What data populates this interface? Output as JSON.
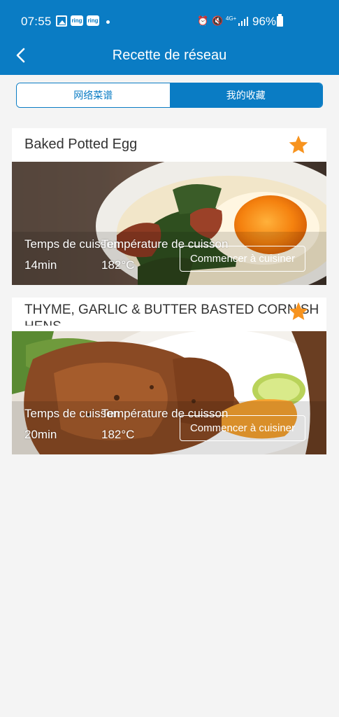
{
  "status": {
    "time": "07:55",
    "ring_label": "ring",
    "network": "4G+",
    "battery": "96%"
  },
  "header": {
    "title": "Recette de réseau"
  },
  "tabs": [
    {
      "label": "网络菜谱"
    },
    {
      "label": "我的收藏"
    }
  ],
  "recipes": [
    {
      "title": "Baked Potted Egg",
      "time_label": "Temps de cuisson",
      "temp_label": "Température de cuisson",
      "time": "14min",
      "temp": "182°C",
      "button": "Commencer à cuisiner",
      "favorite": true
    },
    {
      "title": "THYME, GARLIC & BUTTER BASTED CORNISH",
      "title_cut": "HENS",
      "time_label": "Temps de cuisson",
      "temp_label": "Température de cuisson",
      "time": "20min",
      "temp": "182°C",
      "button": "Commencer à cuisiner",
      "favorite": true
    }
  ],
  "colors": {
    "accent": "#0a7cc4",
    "star": "#f7931e"
  },
  "icons": {
    "back": "arrow-left-icon",
    "favorite": "star-icon"
  }
}
